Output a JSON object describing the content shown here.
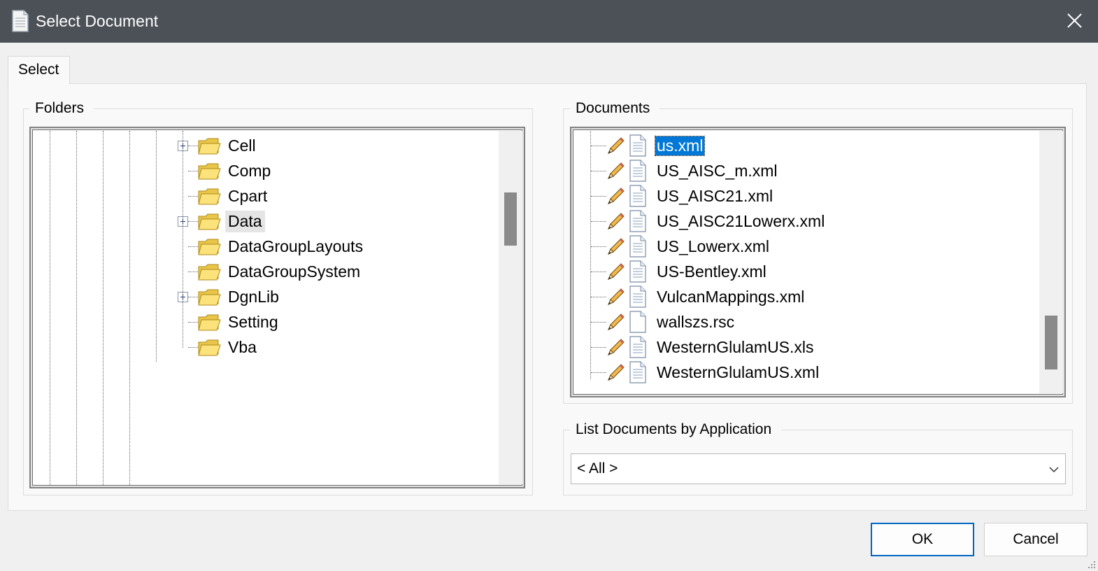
{
  "window": {
    "title": "Select Document",
    "title_icon": "document-icon",
    "close_icon": "close-icon",
    "colors": {
      "titlebar": "#4b5157",
      "selection": "#0078d7",
      "default_button_border": "#0067c0"
    }
  },
  "tabs": [
    {
      "label": "Select",
      "active": true
    }
  ],
  "folders": {
    "label": "Folders",
    "items": [
      {
        "label": "Cell",
        "expandable": true,
        "icon": "folder-icon"
      },
      {
        "label": "Comp",
        "expandable": false,
        "icon": "folder-icon"
      },
      {
        "label": "Cpart",
        "expandable": false,
        "icon": "folder-icon"
      },
      {
        "label": "Data",
        "expandable": true,
        "icon": "folder-icon",
        "highlighted": true
      },
      {
        "label": "DataGroupLayouts",
        "expandable": false,
        "icon": "folder-icon"
      },
      {
        "label": "DataGroupSystem",
        "expandable": false,
        "icon": "folder-icon"
      },
      {
        "label": "DgnLib",
        "expandable": true,
        "icon": "folder-icon"
      },
      {
        "label": "Setting",
        "expandable": false,
        "icon": "folder-icon"
      },
      {
        "label": "Vba",
        "expandable": false,
        "icon": "folder-icon"
      }
    ]
  },
  "documents": {
    "label": "Documents",
    "items": [
      {
        "label": "us.xml",
        "selected": true,
        "doc_icon": "xml-document-icon"
      },
      {
        "label": "US_AISC_m.xml",
        "selected": false,
        "doc_icon": "xml-document-icon"
      },
      {
        "label": "US_AISC21.xml",
        "selected": false,
        "doc_icon": "xml-document-icon"
      },
      {
        "label": "US_AISC21Lowerx.xml",
        "selected": false,
        "doc_icon": "xml-document-icon"
      },
      {
        "label": "US_Lowerx.xml",
        "selected": false,
        "doc_icon": "xml-document-icon"
      },
      {
        "label": "US-Bentley.xml",
        "selected": false,
        "doc_icon": "xml-document-icon"
      },
      {
        "label": "VulcanMappings.xml",
        "selected": false,
        "doc_icon": "xml-document-icon"
      },
      {
        "label": "wallszs.rsc",
        "selected": false,
        "doc_icon": "blank-document-icon"
      },
      {
        "label": "WesternGlulamUS.xls",
        "selected": false,
        "doc_icon": "xml-document-icon"
      },
      {
        "label": "WesternGlulamUS.xml",
        "selected": false,
        "doc_icon": "xml-document-icon"
      }
    ]
  },
  "filter": {
    "label": "List Documents by Application",
    "value": "< All >"
  },
  "buttons": {
    "ok": "OK",
    "cancel": "Cancel"
  }
}
